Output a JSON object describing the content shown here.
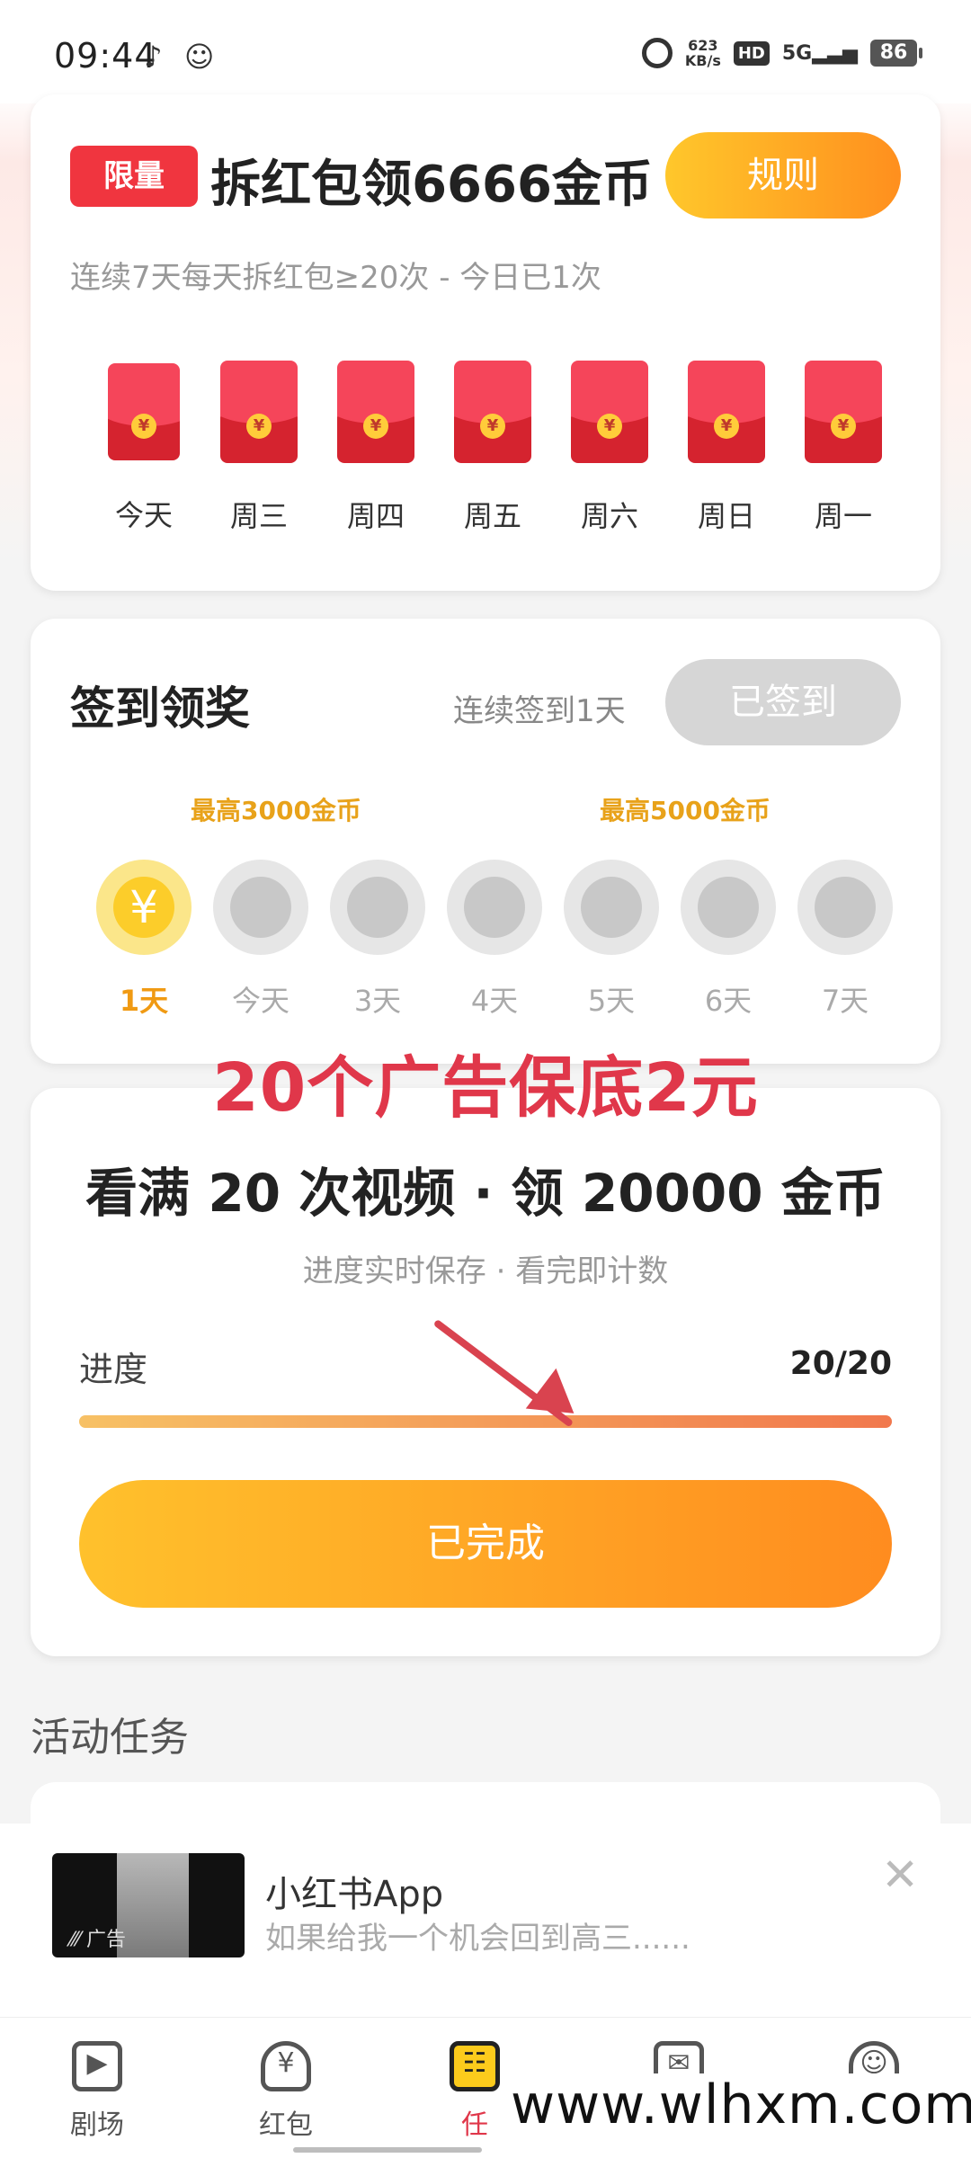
{
  "status_bar": {
    "time": "09:44",
    "app_icons": [
      "tiktok-icon",
      "dewu-icon"
    ],
    "net_speed_value": "623",
    "net_speed_unit": "KB/s",
    "hd": "HD",
    "signal": "5G",
    "battery": "86"
  },
  "red_packet": {
    "badge": "限量",
    "title": "拆红包领6666金币",
    "rules_label": "规则",
    "subtitle": "连续7天每天拆红包≥20次 - 今日已1次",
    "days": [
      "今天",
      "周三",
      "周四",
      "周五",
      "周六",
      "周日",
      "周一"
    ],
    "coin_glyph": "¥"
  },
  "checkin": {
    "title": "签到领奖",
    "streak": "连续签到1天",
    "signed_label": "已签到",
    "max_labels": [
      "最高3000金币",
      "最高5000金币"
    ],
    "days": [
      "1天",
      "今天",
      "3天",
      "4天",
      "5天",
      "6天",
      "7天"
    ],
    "active_index": 0,
    "coin_glyph": "¥"
  },
  "overlay_text": "20个广告保底2元",
  "video_task": {
    "title": "看满 20 次视频 · 领 20000 金币",
    "subtitle": "进度实时保存 · 看完即计数",
    "progress_label": "进度",
    "progress_count": "20/20",
    "progress_fraction": 1.0,
    "done_label": "已完成"
  },
  "section_title": "活动任务",
  "ad": {
    "tag": "广告",
    "title": "小红书App",
    "description": "如果给我一个机会回到高三......",
    "close": "✕"
  },
  "bottom_nav": [
    {
      "label": "剧场",
      "icon": "play-icon",
      "glyph": "▶"
    },
    {
      "label": "红包",
      "icon": "red-packet-icon",
      "glyph": "¥"
    },
    {
      "label": "任",
      "icon": "task-list-icon",
      "glyph": "☷"
    },
    {
      "label": "",
      "icon": "mail-icon",
      "glyph": "✉"
    },
    {
      "label": "",
      "icon": "profile-icon",
      "glyph": "☺"
    }
  ],
  "watermark_url": "www.wlhxm.com",
  "colors": {
    "accent_orange": "#ff8c1f",
    "accent_yellow": "#ffc12c",
    "red": "#f0353f",
    "coin_gold": "#f09a13"
  }
}
